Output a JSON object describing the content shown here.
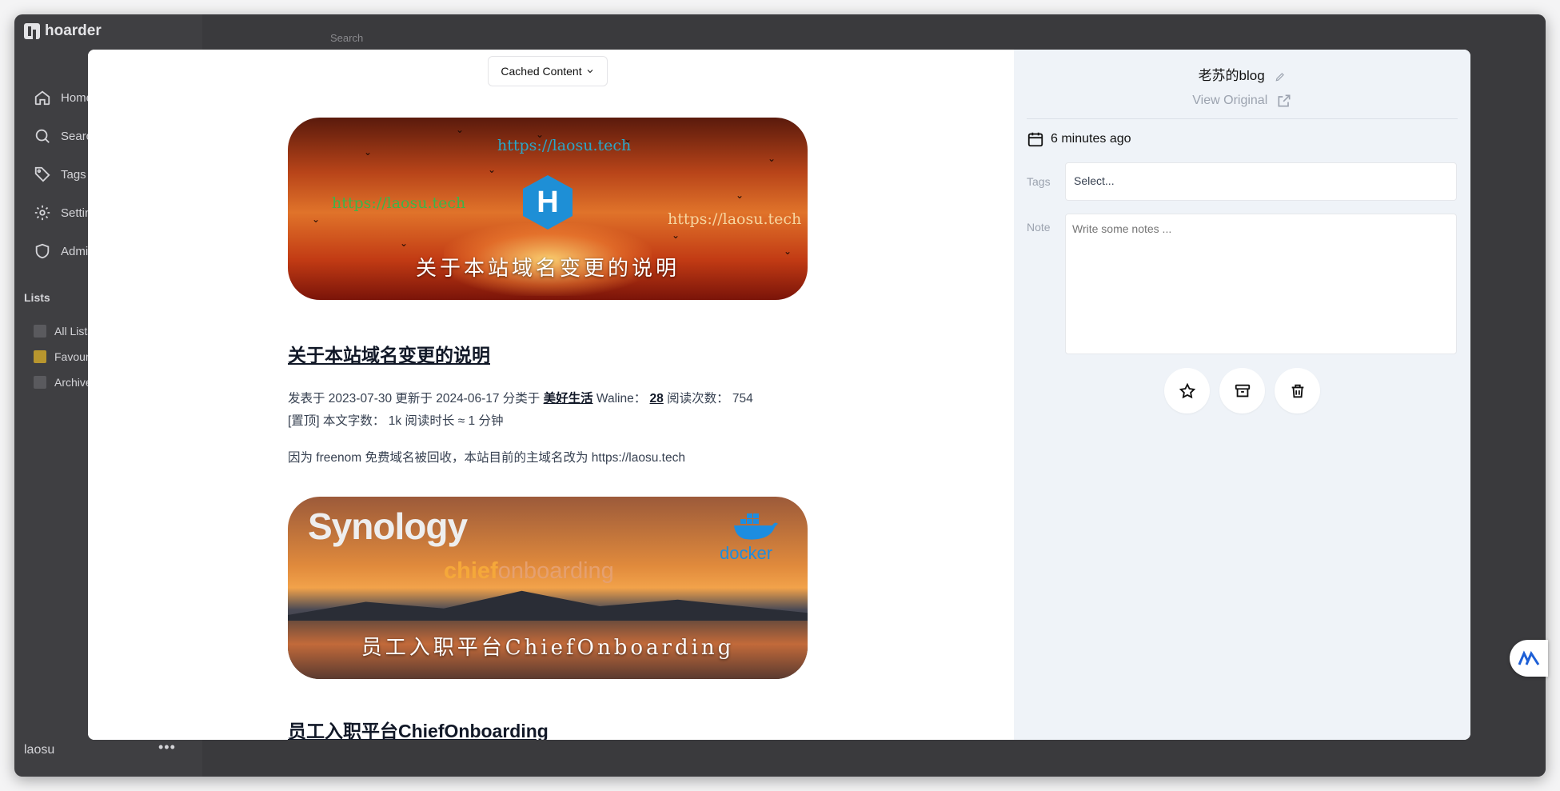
{
  "app": {
    "name": "hoarder"
  },
  "background": {
    "search_placeholder": "Search",
    "nav": [
      {
        "label": "Home",
        "icon": "home-icon"
      },
      {
        "label": "Search",
        "icon": "search-icon"
      },
      {
        "label": "Tags",
        "icon": "tag-icon"
      },
      {
        "label": "Settings",
        "icon": "gear-icon"
      },
      {
        "label": "Admin",
        "icon": "shield-icon"
      }
    ],
    "lists_title": "Lists",
    "lists": [
      {
        "label": "All Lists"
      },
      {
        "label": "Favourites"
      },
      {
        "label": "Archive"
      }
    ],
    "user": "laosu",
    "user_menu": "•••"
  },
  "modal": {
    "view_mode": "Cached Content",
    "article": {
      "banner1_urls": [
        "https://laosu.tech",
        "https://laosu.tech",
        "https://laosu.tech"
      ],
      "banner1_caption": "关于本站域名变更的说明",
      "heading1": "关于本站域名变更的说明",
      "meta_line1_prefix": "发表于 2023-07-30 更新于 2024-06-17 分类于 ",
      "meta_category": "美好生活",
      "meta_waline_label": " Waline： ",
      "meta_comments": "28",
      "meta_reads": " 阅读次数： 754",
      "meta_line2": "[置顶] 本文字数： 1k 阅读时长 ≈ 1 分钟",
      "paragraph1": "因为 freenom 免费域名被回收，本站目前的主域名改为 https://laosu.tech",
      "banner2_brand": "Synology",
      "banner2_chief_a": "chief",
      "banner2_chief_b": "onboarding",
      "banner2_docker": "docker",
      "banner2_caption": "员工入职平台ChiefOnboarding",
      "heading2": "员工入职平台ChiefOnboarding"
    },
    "panel": {
      "title": "老苏的blog",
      "view_original": "View Original",
      "date": "6 minutes ago",
      "tags_label": "Tags",
      "tags_placeholder": "Select...",
      "note_label": "Note",
      "note_placeholder": "Write some notes ..."
    }
  }
}
